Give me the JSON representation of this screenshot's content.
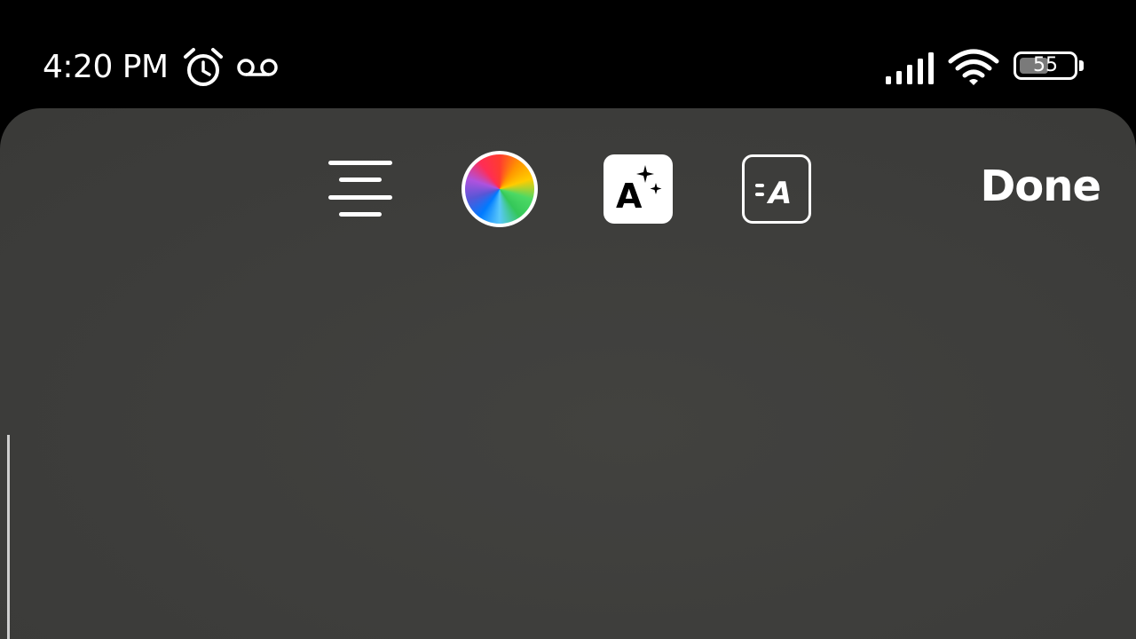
{
  "status_bar": {
    "time": "4:20 PM",
    "battery_level": "55",
    "battery_fraction": 0.55,
    "icons": [
      "alarm-icon",
      "voicemail-icon",
      "signal-icon",
      "wifi-icon",
      "battery-icon"
    ]
  },
  "toolbar": {
    "icons": [
      "text-align-center-icon",
      "color-wheel-icon",
      "text-effects-icon",
      "text-style-icon"
    ],
    "effects_glyph": "A",
    "style_glyph": "A",
    "done_label": "Done"
  },
  "colors": {
    "panel_background": "#3d3d3b",
    "status_background": "#000000",
    "foreground": "#ffffff"
  }
}
